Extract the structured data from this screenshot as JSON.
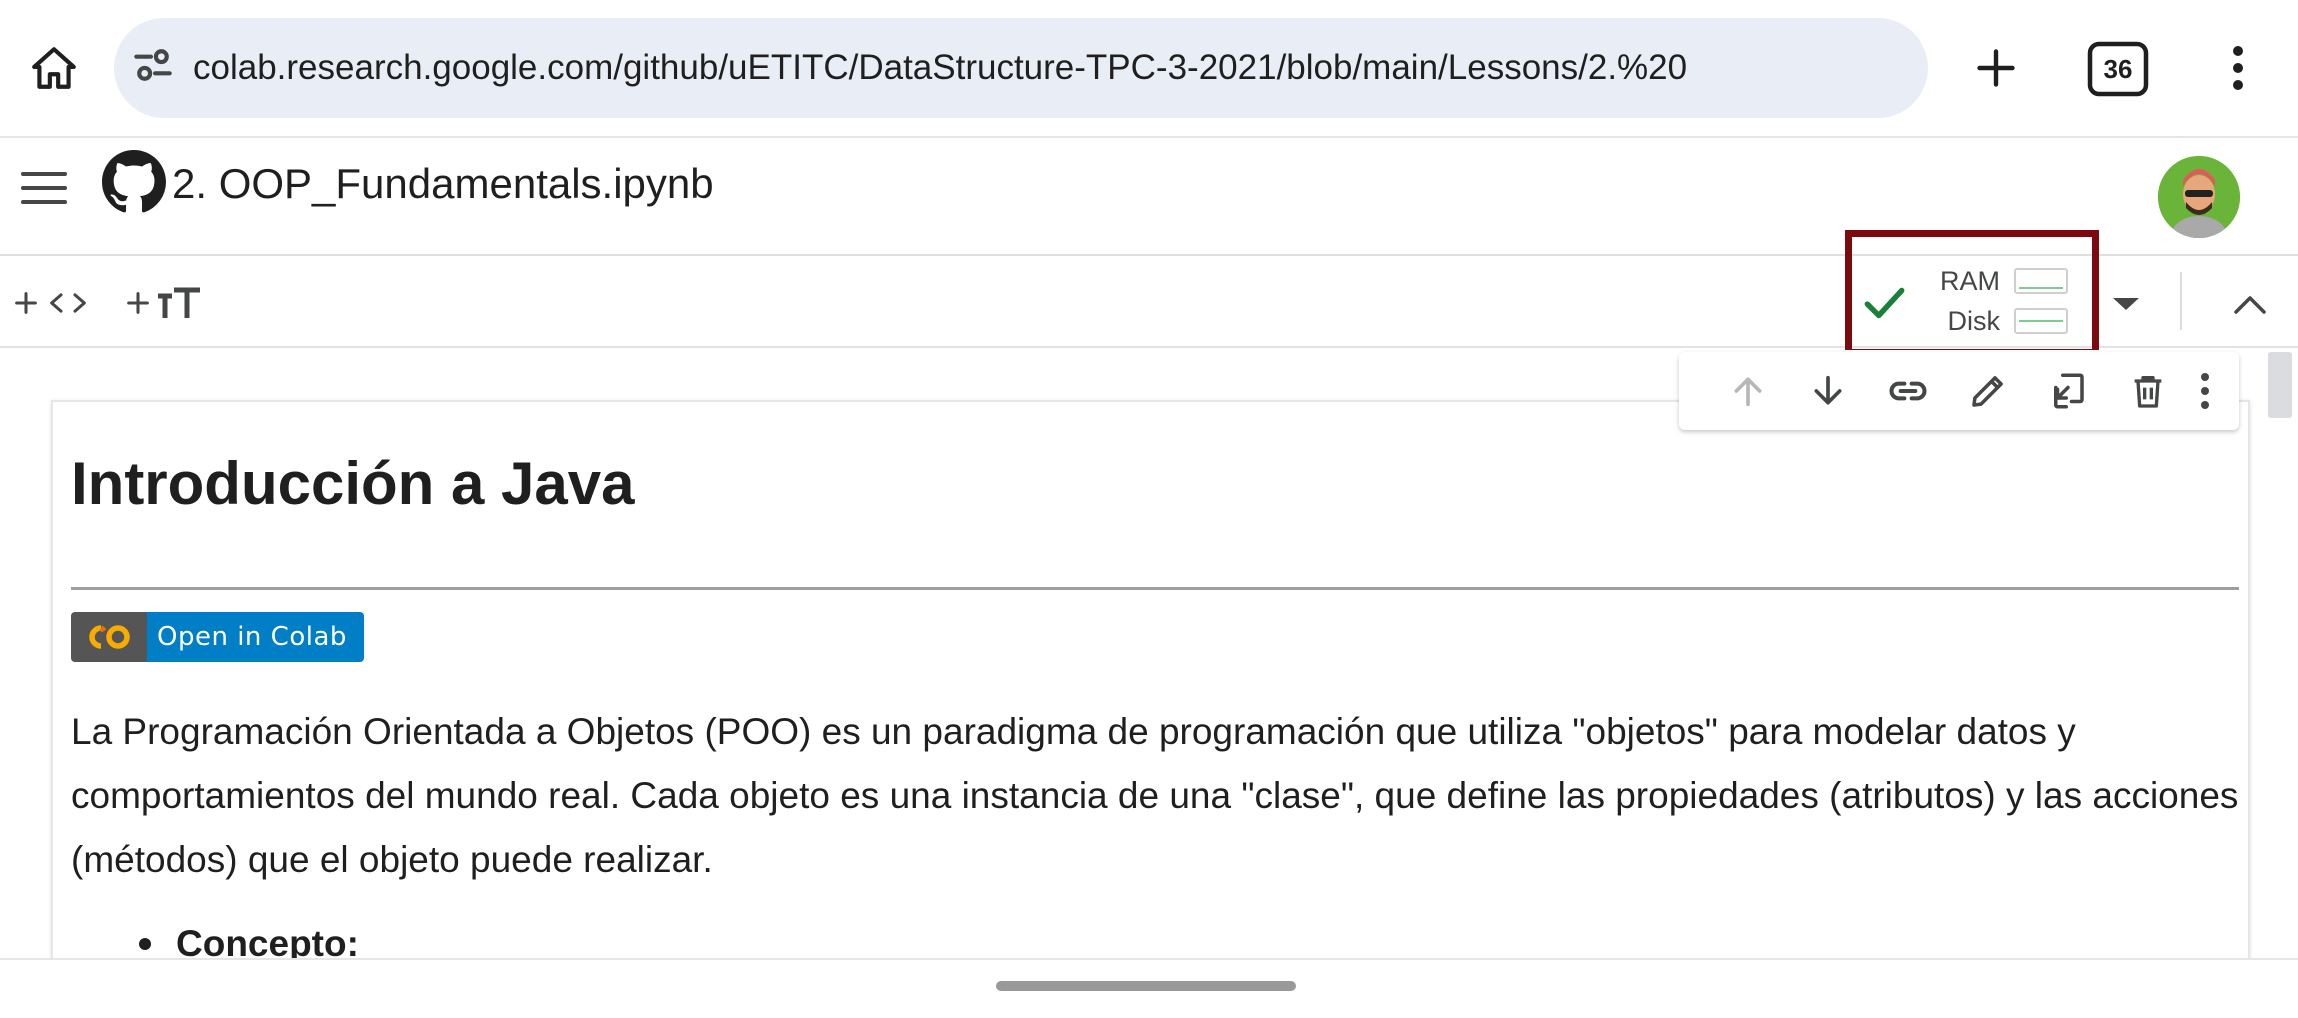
{
  "browser": {
    "url": "colab.research.google.com/github/uETITC/DataStructure-TPC-3-2021/blob/main/Lessons/2.%20",
    "tab_count": "36"
  },
  "colab": {
    "notebook_title": "2. OOP_Fundamentals.ipynb",
    "toolbar": {
      "ram_label": "RAM",
      "disk_label": "Disk"
    }
  },
  "cell": {
    "heading": "Introducción a Java",
    "badge_label": "Open in Colab",
    "paragraph": "La Programación Orientada a Objetos (POO) es un paradigma de programación que utiliza \"objetos\" para modelar datos y comportamientos del mundo real. Cada objeto es una instancia de una \"clase\", que define las propiedades (atributos) y las acciones (métodos) que el objeto puede realizar.",
    "bullets": [
      "Concepto:"
    ]
  },
  "colors": {
    "highlight_border": "#7b0a0f",
    "badge_blue": "#007ec6",
    "badge_gray": "#555555",
    "connected_green": "#188038",
    "omnibox_bg": "#e9eef6"
  },
  "icons": {
    "browser": [
      "home-icon",
      "tune-icon",
      "plus-icon",
      "tab-switcher-icon",
      "more-vert-icon"
    ],
    "colab": [
      "menu-icon",
      "github-icon",
      "check-icon",
      "arrow-drop-down-icon",
      "chevron-up-icon"
    ],
    "cell_toolbar": [
      "arrow-up-icon",
      "arrow-down-icon",
      "link-icon",
      "edit-icon",
      "mirror-cell-icon",
      "delete-icon",
      "more-vert-icon"
    ]
  }
}
